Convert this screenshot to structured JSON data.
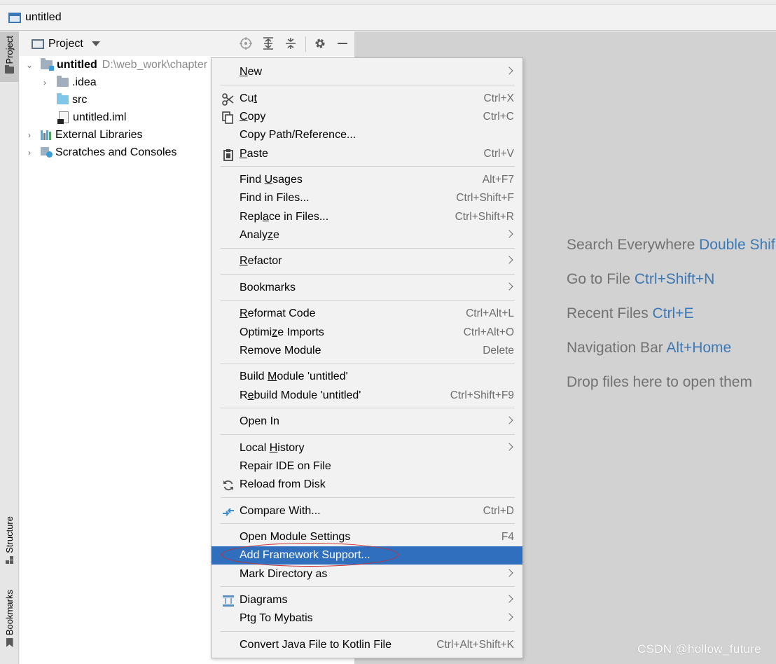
{
  "window": {
    "title": "untitled"
  },
  "left_strip": {
    "project_tab": "Project",
    "structure_tab": "Structure",
    "bookmarks_tab": "Bookmarks"
  },
  "panel": {
    "title": "Project"
  },
  "tree": {
    "root_name": "untitled",
    "root_path": "D:\\web_work\\chapter",
    "idea": ".idea",
    "src": "src",
    "iml": "untitled.iml",
    "libs": "External Libraries",
    "scratches": "Scratches and Consoles"
  },
  "hints": {
    "search_label": "Search Everywhere ",
    "search_shortcut": "Double Shif",
    "goto_label": "Go to File ",
    "goto_shortcut": "Ctrl+Shift+N",
    "recent_label": "Recent Files ",
    "recent_shortcut": "Ctrl+E",
    "nav_label": "Navigation Bar ",
    "nav_shortcut": "Alt+Home",
    "drop": "Drop files here to open them"
  },
  "menu": {
    "new": {
      "pre": "",
      "u": "N",
      "post": "ew"
    },
    "cut": {
      "pre": "Cu",
      "u": "t",
      "post": "",
      "shortcut": "Ctrl+X"
    },
    "copy": {
      "pre": "",
      "u": "C",
      "post": "opy",
      "shortcut": "Ctrl+C"
    },
    "copy_path": {
      "label": "Copy Path/Reference..."
    },
    "paste": {
      "pre": "",
      "u": "P",
      "post": "aste",
      "shortcut": "Ctrl+V"
    },
    "find_usages": {
      "pre": "Find ",
      "u": "U",
      "post": "sages",
      "shortcut": "Alt+F7"
    },
    "find_in_files": {
      "label": "Find in Files...",
      "shortcut": "Ctrl+Shift+F"
    },
    "replace_in_files": {
      "pre": "Repl",
      "u": "a",
      "post": "ce in Files...",
      "shortcut": "Ctrl+Shift+R"
    },
    "analyze": {
      "pre": "Analy",
      "u": "z",
      "post": "e"
    },
    "refactor": {
      "pre": "",
      "u": "R",
      "post": "efactor"
    },
    "bookmarks": {
      "label": "Bookmarks"
    },
    "reformat": {
      "pre": "",
      "u": "R",
      "post": "eformat Code",
      "shortcut": "Ctrl+Alt+L"
    },
    "optimize": {
      "pre": "Optimi",
      "u": "z",
      "post": "e Imports",
      "shortcut": "Ctrl+Alt+O"
    },
    "remove_module": {
      "label": "Remove Module",
      "shortcut": "Delete"
    },
    "build_module": {
      "pre": "Build ",
      "u": "M",
      "post": "odule 'untitled'"
    },
    "rebuild_module": {
      "pre": "R",
      "u": "e",
      "post": "build Module 'untitled'",
      "shortcut": "Ctrl+Shift+F9"
    },
    "open_in": {
      "label": "Open In"
    },
    "local_history": {
      "pre": "Local ",
      "u": "H",
      "post": "istory"
    },
    "repair_ide": {
      "label": "Repair IDE on File"
    },
    "reload": {
      "label": "Reload from Disk"
    },
    "compare": {
      "label": "Compare With...",
      "shortcut": "Ctrl+D"
    },
    "module_settings": {
      "label": "Open Module Settings",
      "shortcut": "F4"
    },
    "framework": {
      "label": "Add Framework Support..."
    },
    "mark_dir": {
      "label": "Mark Directory as"
    },
    "diagrams": {
      "label": "Diagrams"
    },
    "ptg": {
      "label": "Ptg To Mybatis"
    },
    "convert": {
      "label": "Convert Java File to Kotlin File",
      "shortcut": "Ctrl+Alt+Shift+K"
    }
  },
  "watermark": "CSDN @hollow_future",
  "colors": {
    "selection": "#2f6fbd",
    "shortcut_blue": "#3c78b4",
    "annotation_red": "#cc2b2b"
  }
}
